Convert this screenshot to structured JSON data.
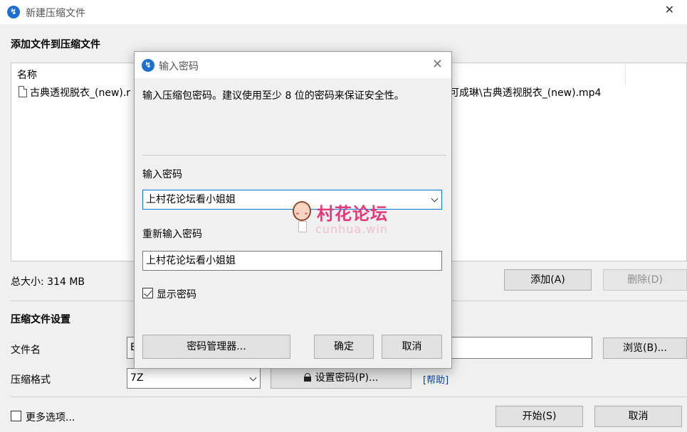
{
  "window": {
    "title": "新建压缩文件",
    "close_glyph": "✕"
  },
  "add_section": {
    "title": "添加文件到压缩文件",
    "column_name": "名称",
    "files": [
      {
        "name_visible": "古典透视脱衣_(new).r",
        "path_visible": "可成琳\\古典透视脱衣_(new).mp4"
      }
    ],
    "total_size_label": "总大小: 314 MB",
    "add_button": "添加(A)",
    "delete_button": "删除(D)"
  },
  "settings": {
    "title": "压缩文件设置",
    "filename_label": "文件名",
    "filename_value": "E",
    "browse_button": "浏览(B)...",
    "format_label": "压缩格式",
    "format_value": "7Z",
    "set_password_button": "设置密码(P)...",
    "help_link": "[帮助]"
  },
  "footer": {
    "more_options_label": "更多选项...",
    "more_options_checked": false,
    "start_button": "开始(S)",
    "cancel_button": "取消"
  },
  "password_dialog": {
    "title": "输入密码",
    "close_glyph": "✕",
    "hint": "输入压缩包密码。建议使用至少 8 位的密码来保证安全性。",
    "password_label": "输入密码",
    "password_value": "上村花论坛看小姐姐",
    "reenter_label": "重新输入密码",
    "reenter_value": "上村花论坛看小姐姐",
    "show_password_label": "显示密码",
    "show_password_checked": true,
    "manager_button": "密码管理器...",
    "ok_button": "确定",
    "cancel_button": "取消"
  },
  "watermark": {
    "text": "村花论坛",
    "url": "cunhua.win"
  },
  "colors": {
    "accent_icon": "#1e6fd0",
    "watermark_pink": "#e3397a",
    "link_blue": "#0645ad"
  }
}
